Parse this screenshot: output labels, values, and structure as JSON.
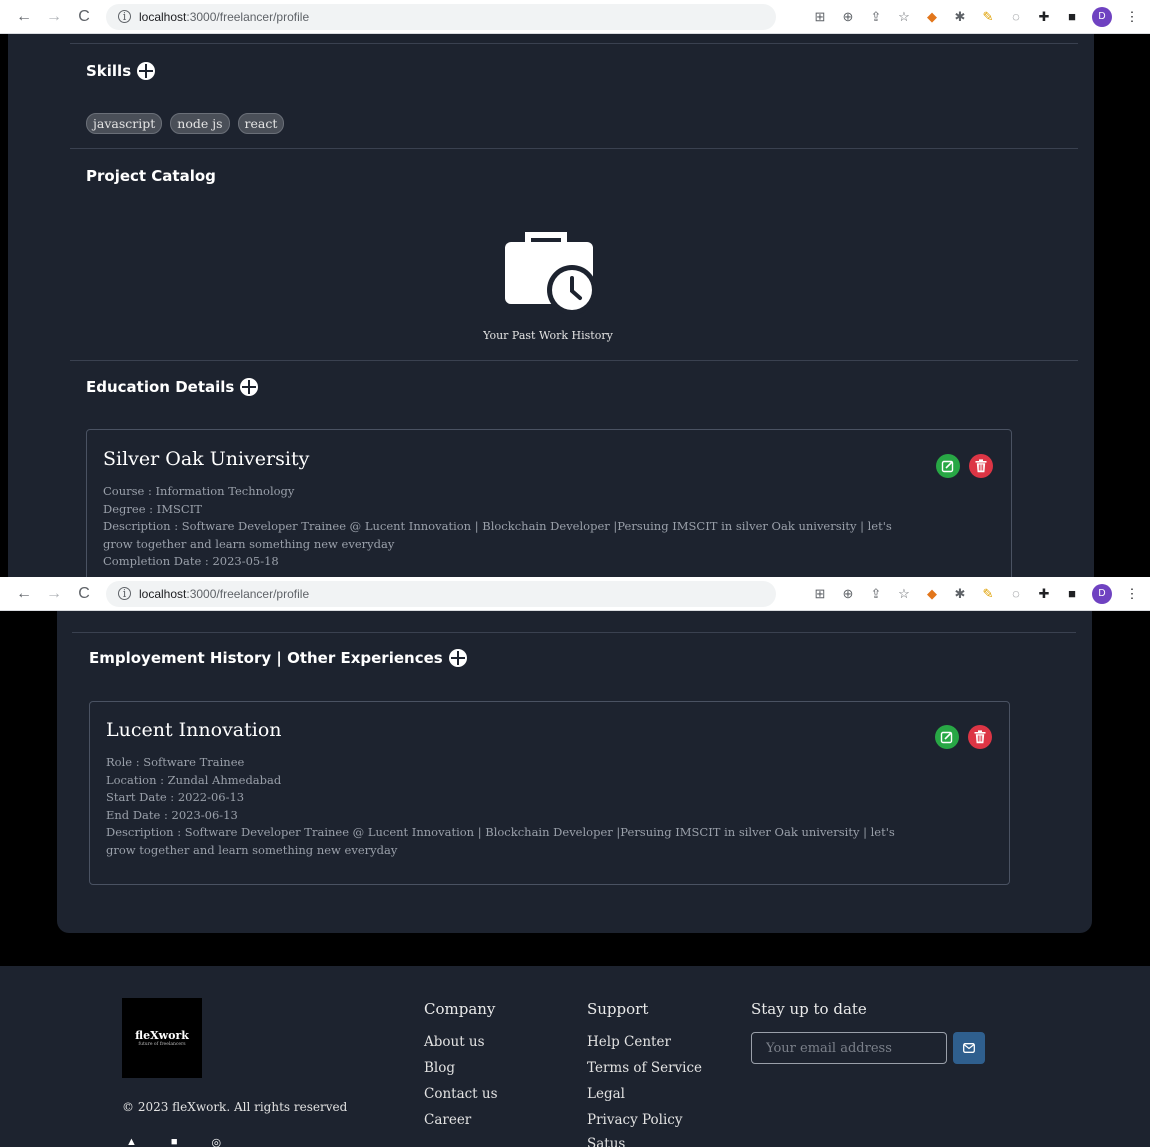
{
  "browser": {
    "url_host": "localhost",
    "url_path": ":3000/freelancer/profile",
    "avatar_letter": "D"
  },
  "skills": {
    "title": "Skills",
    "items": [
      "javascript",
      "node js",
      "react"
    ]
  },
  "project_catalog": {
    "title": "Project Catalog",
    "empty_text": "Your Past Work History"
  },
  "education": {
    "title": "Education Details",
    "entry": {
      "name": "Silver Oak University",
      "course": "Course : Information Technology",
      "degree": "Degree : IMSCIT",
      "description": "Description : Software Developer Trainee @ Lucent Innovation | Blockchain Developer |Persuing IMSCIT in silver Oak university | let's grow together and learn something new everyday",
      "completion": "Completion Date : 2023-05-18"
    }
  },
  "employment": {
    "title": "Employement History | Other Experiences",
    "entry": {
      "name": "Lucent Innovation",
      "role": "Role : Software Trainee",
      "location": "Location : Zundal Ahmedabad",
      "start": "Start Date : 2022-06-13",
      "end": "End Date : 2023-06-13",
      "description": "Description : Software Developer Trainee @ Lucent Innovation | Blockchain Developer |Persuing IMSCIT in silver Oak university | let's grow together and learn something new everyday"
    }
  },
  "footer": {
    "logo_name": "fleXwork",
    "logo_tagline": "future of freelancers",
    "copyright": "© 2023 fleXwork. All rights reserved",
    "company": {
      "title": "Company",
      "links": [
        "About us",
        "Blog",
        "Contact us",
        "Career"
      ]
    },
    "support": {
      "title": "Support",
      "links": [
        "Help Center",
        "Terms of Service",
        "Legal",
        "Privacy Policy",
        "Satus"
      ]
    },
    "newsletter": {
      "title": "Stay up to date",
      "placeholder": "Your email address"
    }
  },
  "colors": {
    "card_bg": "#1d232f",
    "page_bg": "#000000",
    "edit_green": "#28a745",
    "delete_red": "#dc3545",
    "send_blue": "#2f5f8e"
  }
}
